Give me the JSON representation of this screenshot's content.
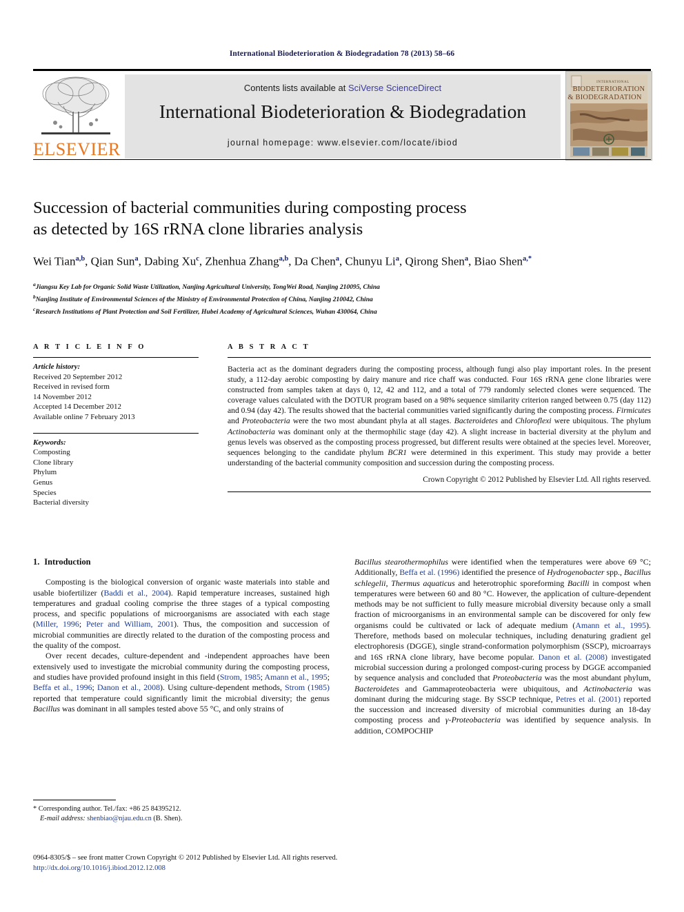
{
  "running_head": "International Biodeterioration & Biodegradation 78 (2013) 58–66",
  "masthead": {
    "contents_prefix": "Contents lists available at ",
    "sciencedirect": "SciVerse ScienceDirect",
    "journal_title": "International Biodeterioration & Biodegradation",
    "homepage": "journal homepage: www.elsevier.com/locate/ibiod",
    "publisher_wordmark": "ELSEVIER",
    "publisher_accent": "#E87722",
    "link_color": "#3a3aa0",
    "cover_title_line1": "INTERNATIONAL",
    "cover_title_line2": "BIODETERIORATION",
    "cover_title_line3": "& BIODEGRADATION"
  },
  "article": {
    "title_line1": "Succession of bacterial communities during composting process",
    "title_line2": "as detected by 16S rRNA clone libraries analysis",
    "authors": [
      {
        "name": "Wei Tian",
        "sup": "a,b",
        "sep": ", "
      },
      {
        "name": "Qian Sun",
        "sup": "a",
        "sep": ", "
      },
      {
        "name": "Dabing Xu",
        "sup": "c",
        "sep": ", "
      },
      {
        "name": "Zhenhua Zhang",
        "sup": "a,b",
        "sep": ", "
      },
      {
        "name": "Da Chen",
        "sup": "a",
        "sep": ", "
      },
      {
        "name": "Chunyu Li",
        "sup": "a",
        "sep": ", "
      },
      {
        "name": "Qirong Shen",
        "sup": "a",
        "sep": ", "
      },
      {
        "name": "Biao Shen",
        "sup": "a,*",
        "sep": ""
      }
    ],
    "affiliations": [
      {
        "marker": "a",
        "text": "Jiangsu Key Lab for Organic Solid Waste Utilization, Nanjing Agricultural University, TongWei Road, Nanjing 210095, China"
      },
      {
        "marker": "b",
        "text": "Nanjing Institute of Environmental Sciences of the Ministry of Environmental Protection of China, Nanjing 210042, China"
      },
      {
        "marker": "c",
        "text": "Research Institutions of Plant Protection and Soil Fertilizer, Hubei Academy of Agricultural Sciences, Wuhan 430064, China"
      }
    ]
  },
  "article_info": {
    "heading": "A R T I C L E   I N F O",
    "history_label": "Article history:",
    "history": [
      "Received 20 September 2012",
      "Received in revised form",
      "14 November 2012",
      "Accepted 14 December 2012",
      "Available online 7 February 2013"
    ],
    "keywords_label": "Keywords:",
    "keywords": [
      "Composting",
      "Clone library",
      "Phylum",
      "Genus",
      "Species",
      "Bacterial diversity"
    ]
  },
  "abstract": {
    "heading": "A B S T R A C T",
    "paragraphs": [
      "Bacteria act as the dominant degraders during the composting process, although fungi also play important roles. In the present study, a 112-day aerobic composting by dairy manure and rice chaff was conducted. Four 16S rRNA gene clone libraries were constructed from samples taken at days 0, 12, 42 and 112, and a total of 779 randomly selected clones were sequenced. The coverage values calculated with the DOTUR program based on a 98% sequence similarity criterion ranged between 0.75 (day 112) and 0.94 (day 42). The results showed that the bacterial communities varied significantly during the composting process. Firmicutes and Proteobacteria were the two most abundant phyla at all stages. Bacteroidetes and Chloroflexi were ubiquitous. The phylum Actinobacteria was dominant only at the thermophilic stage (day 42). A slight increase in bacterial diversity at the phylum and genus levels was observed as the composting process progressed, but different results were obtained at the species level. Moreover, sequences belonging to the candidate phylum BCR1 were determined in this experiment. This study may provide a better understanding of the bacterial community composition and succession during the composting process."
    ],
    "copyright": "Crown Copyright © 2012 Published by Elsevier Ltd. All rights reserved."
  },
  "introduction": {
    "number": "1.",
    "heading": "Introduction",
    "left_paragraphs": [
      "Composting is the biological conversion of organic waste materials into stable and usable biofertilizer (Baddi et al., 2004). Rapid temperature increases, sustained high temperatures and gradual cooling comprise the three stages of a typical composting process, and specific populations of microorganisms are associated with each stage (Miller, 1996; Peter and William, 2001). Thus, the composition and succession of microbial communities are directly related to the duration of the composting process and the quality of the compost.",
      "Over recent decades, culture-dependent and -independent approaches have been extensively used to investigate the microbial community during the composting process, and studies have provided profound insight in this field (Strom, 1985; Amann et al., 1995; Beffa et al., 1996; Danon et al., 2008). Using culture-dependent methods, Strom (1985) reported that temperature could significantly limit the microbial diversity; the genus Bacillus was dominant in all samples tested above 55 °C, and only strains of"
    ],
    "right_paragraphs": [
      "Bacillus stearothermophilus were identified when the temperatures were above 69 °C; Additionally, Beffa et al. (1996) identified the presence of Hydrogenobacter spp., Bacillus schlegelii, Thermus aquaticus and heterotrophic sporeforming Bacilli in compost when temperatures were between 60 and 80 °C. However, the application of culture-dependent methods may be not sufficient to fully measure microbial diversity because only a small fraction of microorganisms in an environmental sample can be discovered for only few organisms could be cultivated or lack of adequate medium (Amann et al., 1995). Therefore, methods based on molecular techniques, including denaturing gradient gel electrophoresis (DGGE), single strand-conformation polymorphism (SSCP), microarrays and 16S rRNA clone library, have become popular. Danon et al. (2008) investigated microbial succession during a prolonged compost-curing process by DGGE accompanied by sequence analysis and concluded that Proteobacteria was the most abundant phylum, Bacteroidetes and Gammaproteobacteria were ubiquitous, and Actinobacteria was dominant during the midcuring stage. By SSCP technique, Petres et al. (2001) reported the succession and increased diversity of microbial communities during an 18-day composting process and γ-Proteobacteria was identified by sequence analysis. In addition, COMPOCHIP"
    ]
  },
  "footnote": {
    "corresponding": "* Corresponding author. Tel./fax: +86 25 84395212.",
    "email_label": "E-mail address:",
    "email": "shenbiao@njau.edu.cn",
    "email_suffix": "(B. Shen)."
  },
  "page_footer": {
    "line1": "0964-8305/$ – see front matter Crown Copyright © 2012 Published by Elsevier Ltd. All rights reserved.",
    "doi": "http://dx.doi.org/10.1016/j.ibiod.2012.12.008"
  }
}
